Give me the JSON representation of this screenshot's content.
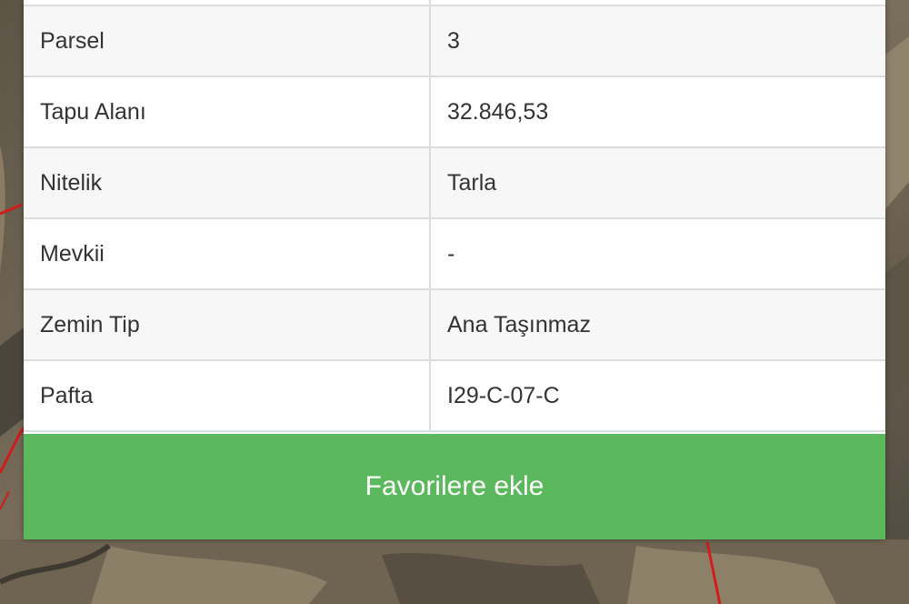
{
  "properties": [
    {
      "label": "Parsel",
      "value": "3"
    },
    {
      "label": "Tapu Alanı",
      "value": "32.846,53"
    },
    {
      "label": "Nitelik",
      "value": "Tarla"
    },
    {
      "label": "Mevkii",
      "value": "-"
    },
    {
      "label": "Zemin Tip",
      "value": "Ana Taşınmaz"
    },
    {
      "label": "Pafta",
      "value": "I29-C-07-C"
    }
  ],
  "favorite_button": {
    "label": "Favorilere ekle"
  },
  "colors": {
    "button_green": "#5cb85c",
    "parcel_border_red": "#d01c1c",
    "row_stripe": "#f7f7f7",
    "cell_border": "#dcdcdc"
  }
}
